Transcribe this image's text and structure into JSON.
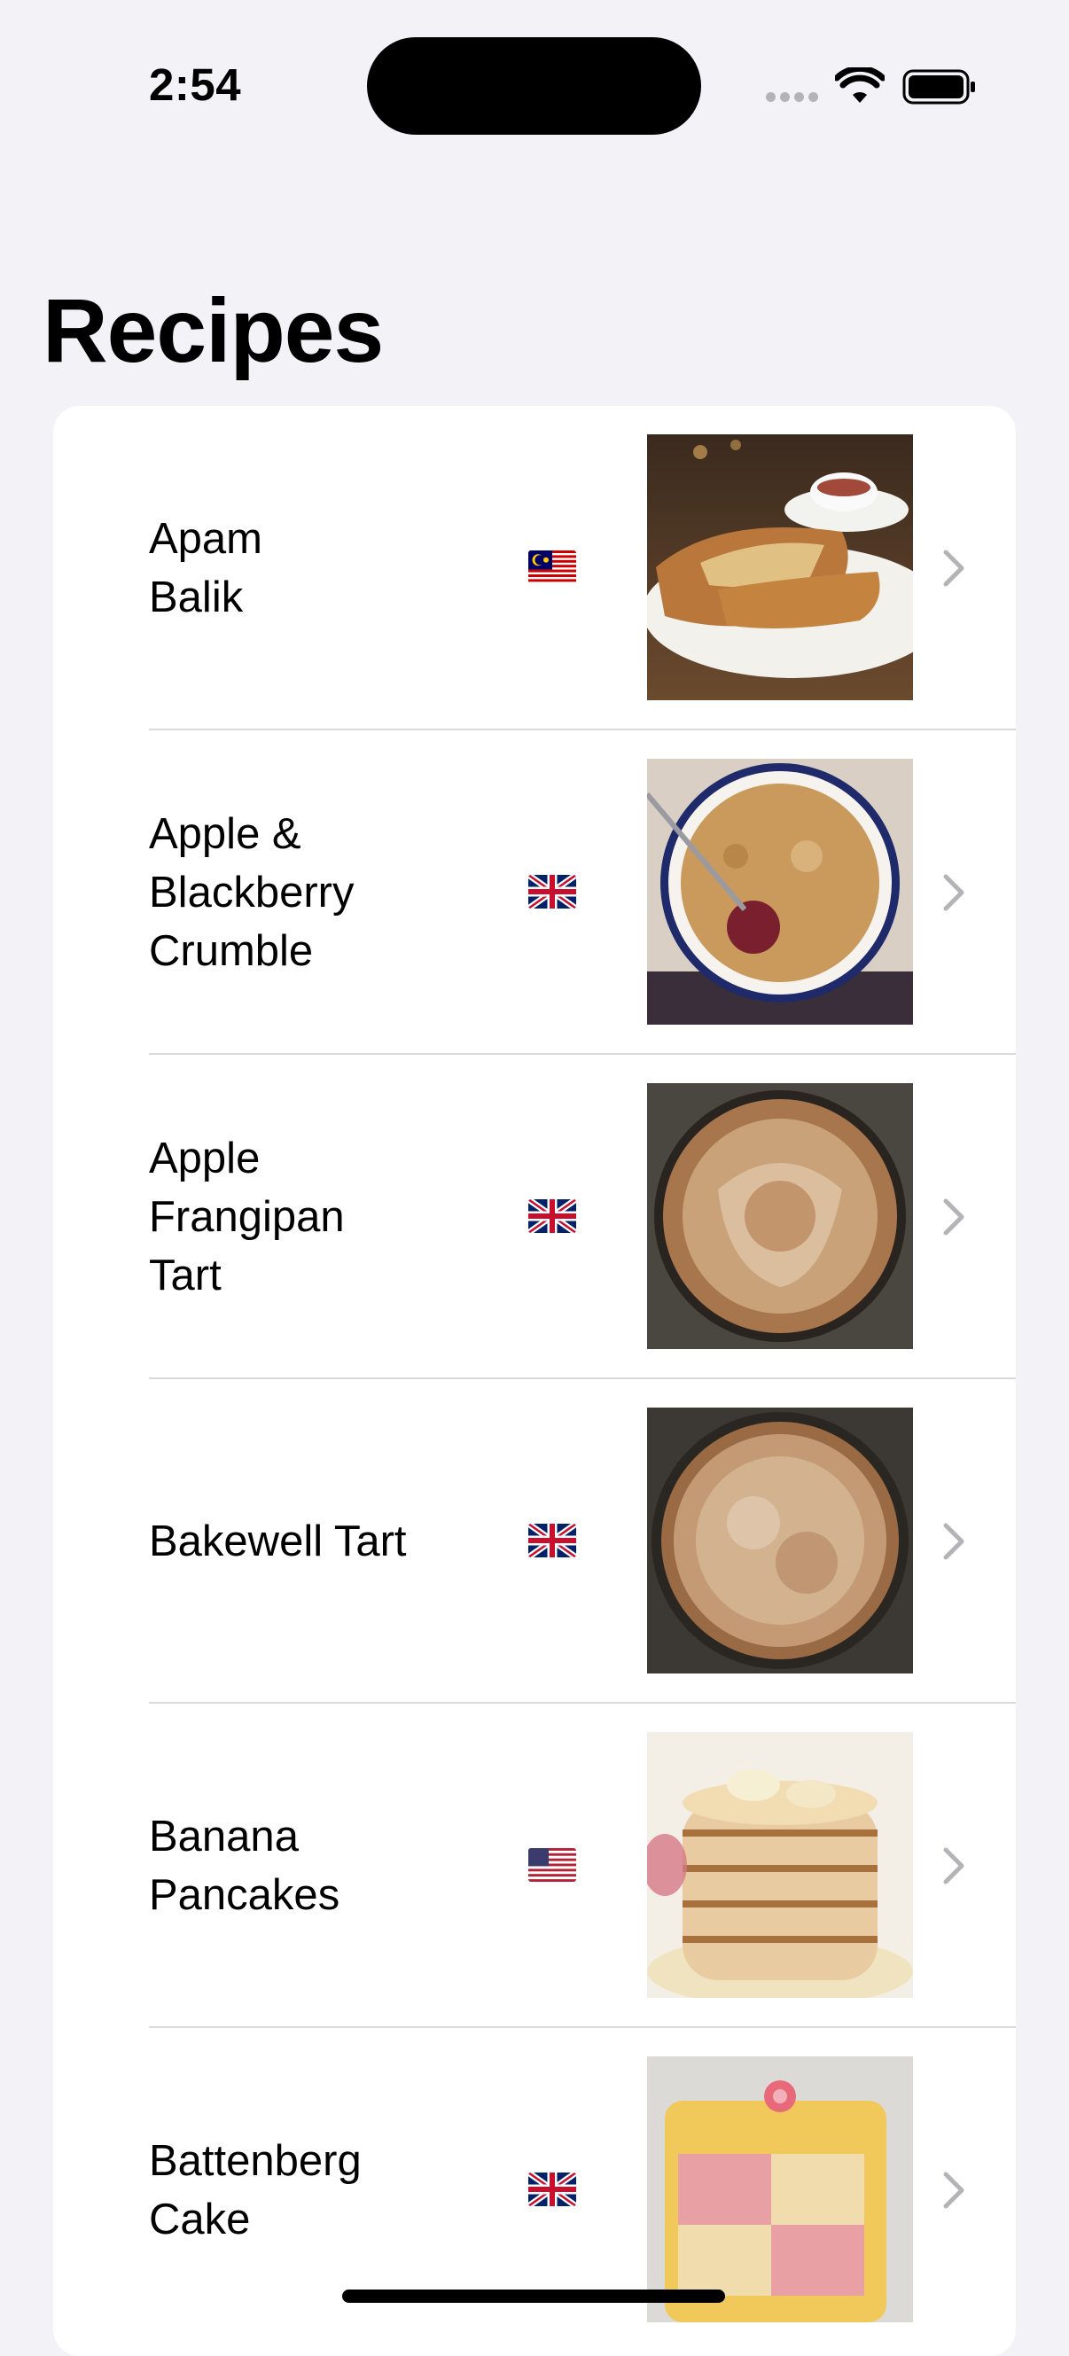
{
  "status_bar": {
    "time": "2:54"
  },
  "nav": {
    "title": "Recipes"
  },
  "recipes": [
    {
      "name": "Apam\nBalik",
      "flag": "malaysia-flag-icon"
    },
    {
      "name": "Apple &\nBlackberry\nCrumble",
      "flag": "uk-flag-icon"
    },
    {
      "name": "Apple\nFrangipan\nTart",
      "flag": "uk-flag-icon"
    },
    {
      "name": "Bakewell Tart",
      "flag": "uk-flag-icon"
    },
    {
      "name": "Banana\nPancakes",
      "flag": "usa-flag-icon"
    },
    {
      "name": "Battenberg\nCake",
      "flag": "uk-flag-icon"
    }
  ]
}
